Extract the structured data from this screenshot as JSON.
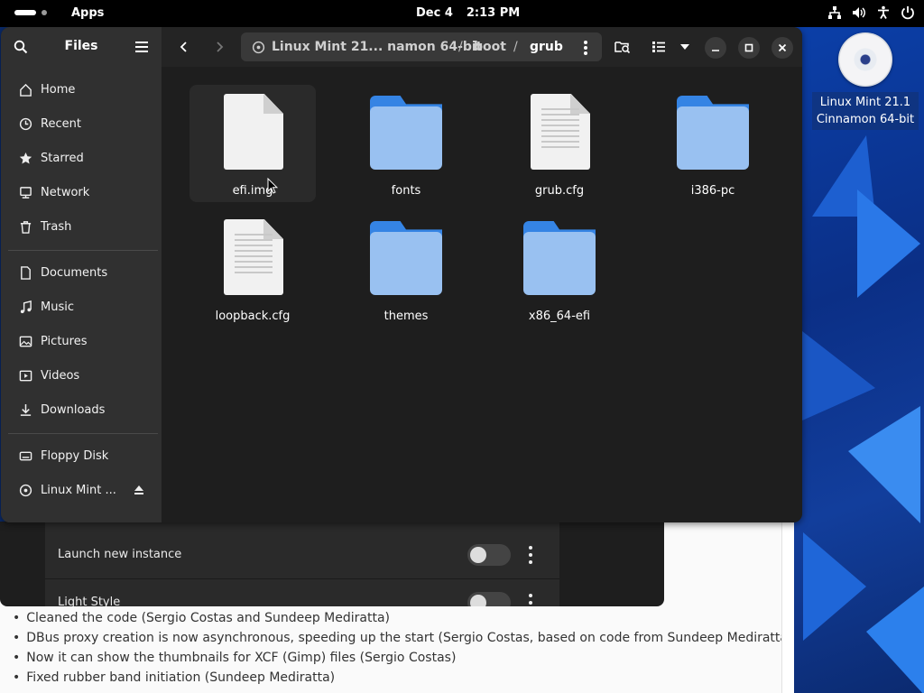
{
  "topbar": {
    "apps_label": "Apps",
    "date": "Dec 4",
    "time": "2:13 PM",
    "tray_icons": [
      "network-icon",
      "volume-icon",
      "accessibility-icon",
      "power-icon"
    ]
  },
  "desktop": {
    "icon_label": "Linux Mint 21.1 Cinnamon 64-bit"
  },
  "files": {
    "title": "Files",
    "sidebar": {
      "places": [
        {
          "label": "Home",
          "icon": "home-icon"
        },
        {
          "label": "Recent",
          "icon": "clock-icon"
        },
        {
          "label": "Starred",
          "icon": "star-icon"
        },
        {
          "label": "Network",
          "icon": "network-icon"
        },
        {
          "label": "Trash",
          "icon": "trash-icon"
        }
      ],
      "bookmarks": [
        {
          "label": "Documents",
          "icon": "document-icon"
        },
        {
          "label": "Music",
          "icon": "music-icon"
        },
        {
          "label": "Pictures",
          "icon": "picture-icon"
        },
        {
          "label": "Videos",
          "icon": "video-icon"
        },
        {
          "label": "Downloads",
          "icon": "download-icon"
        }
      ],
      "devices": [
        {
          "label": "Floppy Disk",
          "icon": "drive-icon"
        },
        {
          "label": "Linux Mint ...",
          "icon": "disc-icon"
        }
      ]
    },
    "path": {
      "root": "Linux Mint 21... namon 64-bit",
      "seg1": "boot",
      "current": "grub"
    },
    "items": [
      {
        "name": "efi.img",
        "type": "file",
        "selected": true
      },
      {
        "name": "fonts",
        "type": "folder"
      },
      {
        "name": "grub.cfg",
        "type": "text"
      },
      {
        "name": "i386-pc",
        "type": "folder"
      },
      {
        "name": "loopback.cfg",
        "type": "text"
      },
      {
        "name": "themes",
        "type": "folder"
      },
      {
        "name": "x86_64-efi",
        "type": "folder"
      }
    ]
  },
  "prefs": {
    "rows": [
      {
        "label": "Launch new instance",
        "toggle": false
      },
      {
        "label": "Light Style",
        "toggle": false
      }
    ]
  },
  "notes": {
    "items": [
      "Cleaned the code (Sergio Costas and Sundeep Mediratta)",
      "DBus proxy creation is now asynchronous, speeding up the start (Sergio Costas, based on code from Sundeep Mediratta)",
      "Now it can show the thumbnails for XCF (Gimp) files (Sergio Costas)",
      "Fixed rubber band initiation (Sundeep Mediratta)"
    ]
  },
  "colors": {
    "folder_blue": "#3584e4",
    "folder_light": "#99c1f1",
    "sidebar_bg": "#303030",
    "view_bg": "#1e1e1e"
  }
}
